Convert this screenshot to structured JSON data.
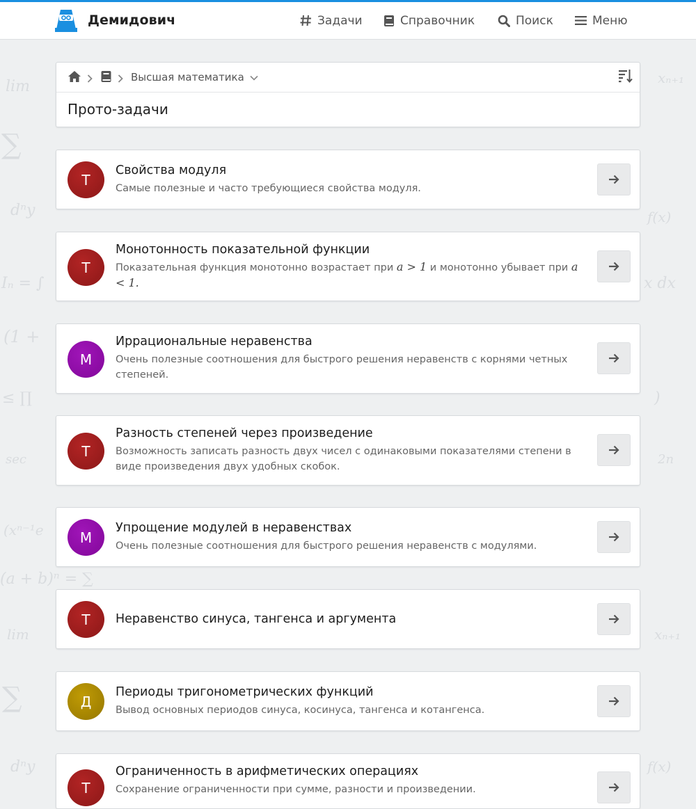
{
  "brand": {
    "name": "Демидович"
  },
  "nav": {
    "tasks": "Задачи",
    "reference": "Справочник",
    "search": "Поиск",
    "menu": "Меню"
  },
  "breadcrumb": {
    "current": "Высшая математика"
  },
  "page": {
    "title": "Прото-задачи"
  },
  "colors": {
    "accent": "#1a8fe0",
    "avatar_red": "#9e1c1c",
    "avatar_purple": "#8e0aa6",
    "avatar_olive": "#a98a00"
  },
  "icons": [
    "home-icon",
    "chevron-right-icon",
    "book-icon",
    "chevron-down-icon",
    "sort-icon",
    "hash-icon",
    "search-icon",
    "menu-icon",
    "arrow-right-icon"
  ],
  "items": [
    {
      "letter": "Т",
      "title": "Свойства модуля",
      "desc": "Самые полезные и часто требующиеся свойства модуля."
    },
    {
      "letter": "Т",
      "title": "Монотонность показательной функции",
      "desc_a": "Показательная функция монотонно возрастает при",
      "desc_b": "и монотонно убывает при",
      "math1": "a > 1",
      "math2": "a < 1."
    },
    {
      "letter": "М",
      "title": "Иррациональные неравенства",
      "desc": "Очень полезные соотношения для быстрого решения неравенств с корнями четных степеней."
    },
    {
      "letter": "Т",
      "title": "Разность степеней через произведение",
      "desc": "Возможность записать разность двух чисел с одинаковыми показателями степени в виде произведения двух удобных скобок."
    },
    {
      "letter": "М",
      "title": "Упрощение модулей в неравенствах",
      "desc": "Очень полезные соотношения для быстрого решения неравенств с модулями."
    },
    {
      "letter": "Т",
      "title": "Неравенство синуса, тангенса и аргумента",
      "desc": ""
    },
    {
      "letter": "Д",
      "title": "Периоды тригонометрических функций",
      "desc": "Вывод основных периодов синуса, косинуса, тангенса и котангенса."
    },
    {
      "letter": "Т",
      "title": "Ограниченность в арифметических операциях",
      "desc": "Сохранение ограниченности при сумме, разности и произведении."
    }
  ]
}
